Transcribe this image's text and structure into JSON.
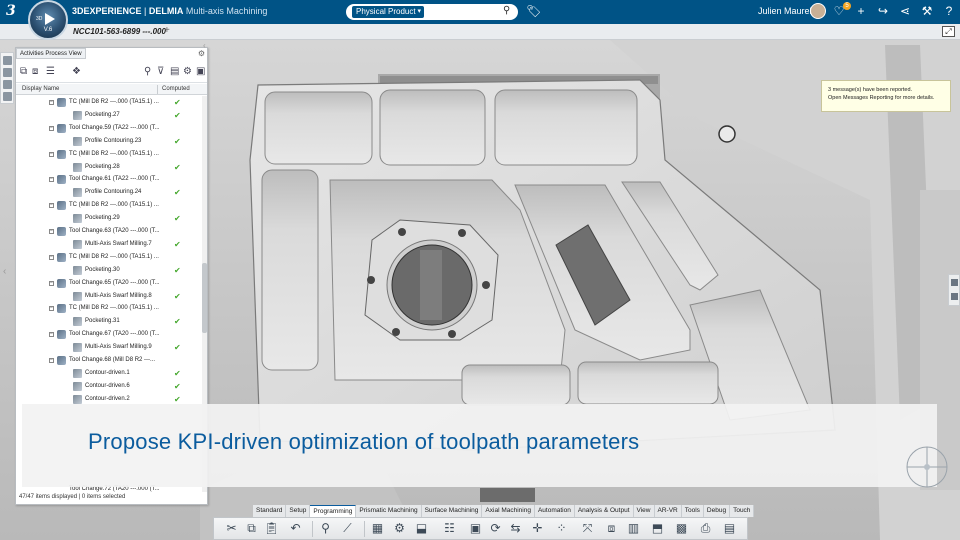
{
  "app": {
    "brand": "3DEXPERIENCE",
    "separator": " | ",
    "product": "DELMIA",
    "app_name": "Multi-axis Machining",
    "compass_version": "V.6",
    "compass_3d": "3D"
  },
  "search": {
    "scope": "Physical Product",
    "placeholder": ""
  },
  "user": {
    "name": "Julien Maurel",
    "notification_count": "5"
  },
  "tab": {
    "title": "NCC101-563-6899 ---.000",
    "add": "+"
  },
  "panel": {
    "tab_label": "Activities Process View",
    "columns": {
      "display_name": "Display Name",
      "computed": "Computed"
    },
    "rows": [
      {
        "label": "TC (Mill D8 R2 ---.000 (TA15.1) ...",
        "kind": "tc",
        "computed": true
      },
      {
        "label": "Pocketing.27",
        "kind": "op",
        "computed": true
      },
      {
        "label": "Tool Change.59 (TA22 ---.000 (T...",
        "kind": "tc",
        "computed": false
      },
      {
        "label": "Profile Contouring.23",
        "kind": "op",
        "computed": true
      },
      {
        "label": "TC (Mill D8 R2 ---.000 (TA15.1) ...",
        "kind": "tc",
        "computed": false
      },
      {
        "label": "Pocketing.28",
        "kind": "op",
        "computed": true
      },
      {
        "label": "Tool Change.61 (TA22 ---.000 (T...",
        "kind": "tc",
        "computed": false
      },
      {
        "label": "Profile Contouring.24",
        "kind": "op",
        "computed": true
      },
      {
        "label": "TC (Mill D8 R2 ---.000 (TA15.1) ...",
        "kind": "tc",
        "computed": false
      },
      {
        "label": "Pocketing.29",
        "kind": "op",
        "computed": true
      },
      {
        "label": "Tool Change.63 (TA20 ---.000 (T...",
        "kind": "tc",
        "computed": false
      },
      {
        "label": "Multi-Axis Swarf Milling.7",
        "kind": "op",
        "computed": true
      },
      {
        "label": "TC (Mill D8 R2 ---.000 (TA15.1) ...",
        "kind": "tc",
        "computed": false
      },
      {
        "label": "Pocketing.30",
        "kind": "op",
        "computed": true
      },
      {
        "label": "Tool Change.65 (TA20 ---.000 (T...",
        "kind": "tc",
        "computed": false
      },
      {
        "label": "Multi-Axis Swarf Milling.8",
        "kind": "op",
        "computed": true
      },
      {
        "label": "TC (Mill D8 R2 ---.000 (TA15.1) ...",
        "kind": "tc",
        "computed": false
      },
      {
        "label": "Pocketing.31",
        "kind": "op",
        "computed": true
      },
      {
        "label": "Tool Change.67 (TA20 ---.000 (T...",
        "kind": "tc",
        "computed": false
      },
      {
        "label": "Multi-Axis Swarf Milling.9",
        "kind": "op",
        "computed": true
      },
      {
        "label": "Tool Change.68 (Mill D8 R2 ---...",
        "kind": "tc",
        "computed": false
      },
      {
        "label": "Contour-driven.1",
        "kind": "op",
        "computed": true
      },
      {
        "label": "Contour-driven.6",
        "kind": "op",
        "computed": true
      },
      {
        "label": "Contour-driven.2",
        "kind": "op",
        "computed": true
      }
    ],
    "status": "47/47 items displayed | 0 items selected",
    "partial_row": "Tool Change.72 (TA20 ---.000 (T..."
  },
  "message": {
    "line1": "3 message(s) have been reported.",
    "line2": "Open Messages Reporting for more details."
  },
  "caption": "Propose KPI-driven optimization of toolpath parameters",
  "section_tabs": [
    "Standard",
    "Setup",
    "Programming",
    "Prismatic Machining",
    "Surface Machining",
    "Axial Machining",
    "Automation",
    "Analysis & Output",
    "View",
    "AR-VR",
    "Tools",
    "Debug",
    "Touch"
  ],
  "active_section_tab": "Programming",
  "colors": {
    "top_bar": "#005386",
    "caption_text": "#0b5c9e",
    "computed_check": "#46a82e"
  },
  "icons": [
    "ds-logo-icon",
    "compass-icon",
    "search-icon",
    "tag-icon",
    "share-icon",
    "add-icon",
    "forward-icon",
    "network-icon",
    "tools-icon",
    "help-icon",
    "expand-icon"
  ]
}
